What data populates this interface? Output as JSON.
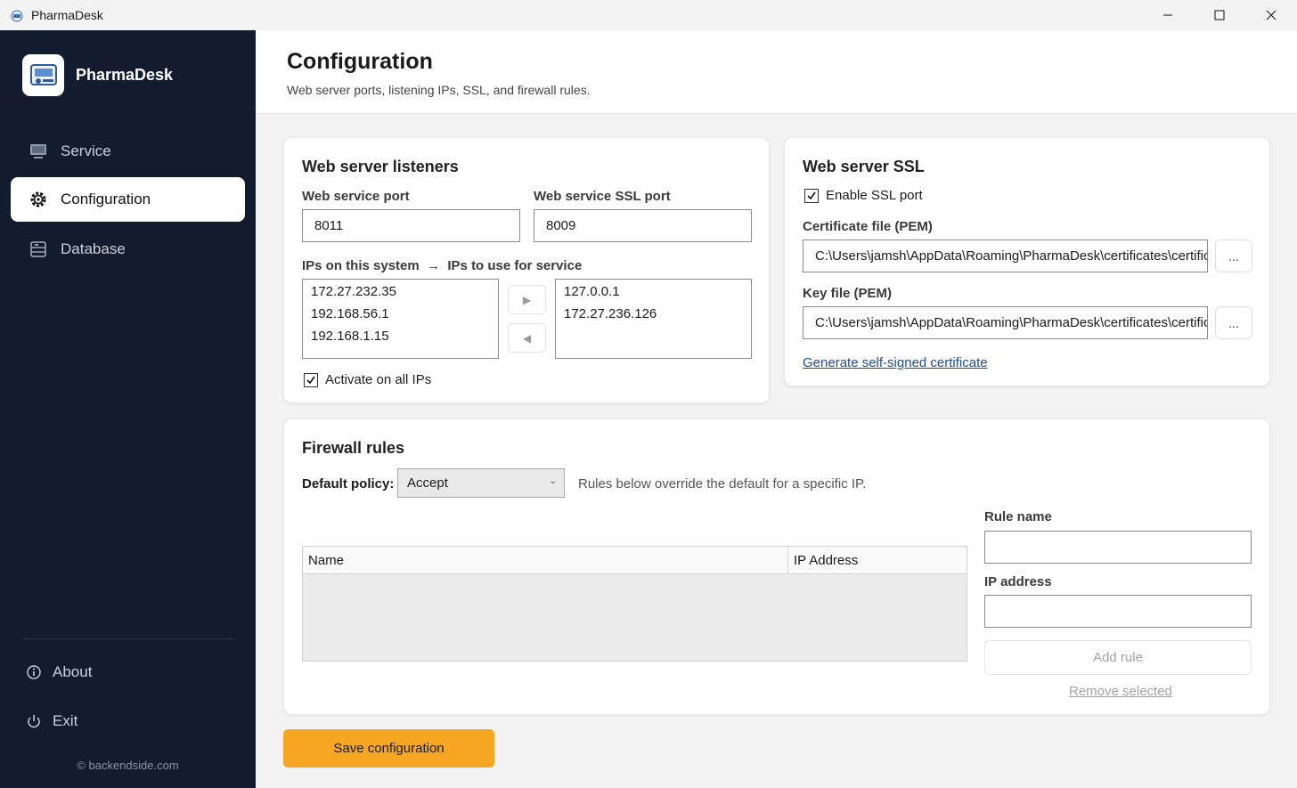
{
  "window": {
    "title": "PharmaDesk",
    "minimize_icon": "minimize-icon",
    "maximize_icon": "maximize-icon",
    "close_icon": "close-icon"
  },
  "sidebar": {
    "brand": "PharmaDesk",
    "items": [
      {
        "label": "Service",
        "icon": "monitor-icon",
        "active": false
      },
      {
        "label": "Configuration",
        "icon": "gear-icon",
        "active": true
      },
      {
        "label": "Database",
        "icon": "database-icon",
        "active": false
      }
    ],
    "bottom": [
      {
        "label": "About",
        "icon": "info-icon"
      },
      {
        "label": "Exit",
        "icon": "power-icon"
      }
    ],
    "copyright": "© backendside.com"
  },
  "header": {
    "title": "Configuration",
    "subtitle": "Web server ports, listening IPs, SSL, and firewall rules."
  },
  "listeners": {
    "title": "Web server listeners",
    "port_label": "Web service port",
    "port_value": "8011",
    "ssl_port_label": "Web service SSL port",
    "ssl_port_value": "8009",
    "ips_label": "IPs on this system  →  IPs to use for service",
    "available_ips": [
      "172.27.232.35",
      "192.168.56.1",
      "192.168.1.15"
    ],
    "selected_ips": [
      "127.0.0.1",
      "172.27.236.126"
    ],
    "activate_all_label": "Activate on all IPs",
    "activate_all_checked": true
  },
  "ssl": {
    "title": "Web server SSL",
    "enable_label": "Enable SSL port",
    "enable_checked": true,
    "cert_label": "Certificate file (PEM)",
    "cert_value": "C:\\Users\\jamsh\\AppData\\Roaming\\PharmaDesk\\certificates\\certificate.pem",
    "key_label": "Key file (PEM)",
    "key_value": "C:\\Users\\jamsh\\AppData\\Roaming\\PharmaDesk\\certificates\\certificate-key.pem",
    "browse_label": "...",
    "generate_label": "Generate self-signed certificate"
  },
  "firewall": {
    "title": "Firewall rules",
    "policy_label": "Default policy:",
    "policy_value": "Accept",
    "policy_hint": "Rules below override the default for a specific IP.",
    "columns": [
      "Name",
      "IP Address"
    ],
    "rows": [],
    "rule_name_label": "Rule name",
    "rule_name_value": "",
    "ip_label": "IP address",
    "ip_value": "",
    "add_label": "Add rule",
    "remove_label": "Remove selected"
  },
  "save_label": "Save configuration",
  "colors": {
    "sidebar_bg": "#131c2e",
    "accent": "#f5a623",
    "link": "#1f4e96"
  }
}
